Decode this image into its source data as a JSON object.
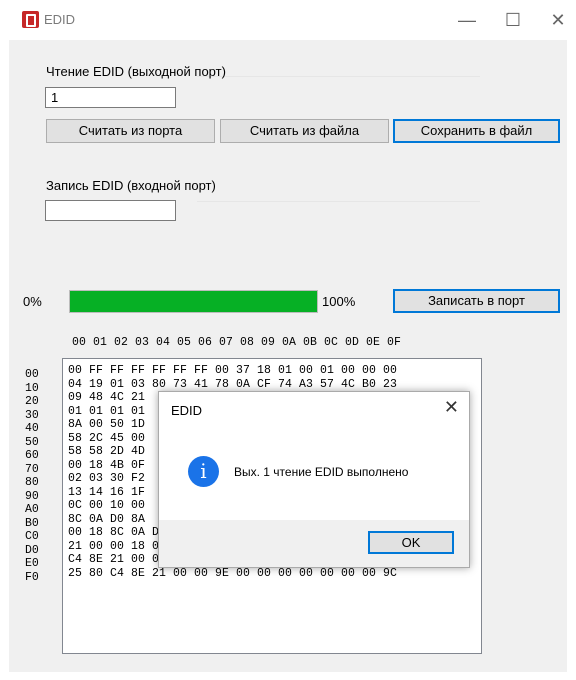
{
  "window": {
    "title": "EDID"
  },
  "read_group": {
    "label": "Чтение EDID (выходной порт)",
    "port_value": "1"
  },
  "buttons": {
    "read_port": "Считать из порта",
    "read_file": "Считать из файла",
    "save_file": "Сохранить в файл",
    "write_port": "Записать в порт"
  },
  "write_group": {
    "label": "Запись EDID (входной порт)",
    "port_value": ""
  },
  "progress": {
    "min_label": "0%",
    "max_label": "100%",
    "value_percent": 100,
    "color": "#06b025"
  },
  "hex": {
    "header": "00 01 02 03 04 05 06 07 08 09 0A 0B 0C 0D 0E 0F",
    "addresses": [
      "00",
      "10",
      "20",
      "30",
      "40",
      "50",
      "60",
      "70",
      "80",
      "90",
      "A0",
      "B0",
      "C0",
      "D0",
      "E0",
      "F0"
    ],
    "rows": [
      "00 FF FF FF FF FF FF 00 37 18 01 00 01 00 00 00",
      "04 19 01 03 80 73 41 78 0A CF 74 A3 57 4C B0 23",
      "09 48 4C 21",
      "01 01 01 01",
      "8A 00 50 1D",
      "58 2C 45 00",
      "58 58 2D 4D",
      "00 18 4B 0F",
      "02 03 30 F2",
      "13 14 16 1F",
      "0C 00 10 00",
      "8C 0A D0 8A",
      "00 18 8C 0A D0 90 20 40 31 20 0C 40 55 00 C4 8E",
      "21 00 00 18 01 1D 00 BC 52 D0 1E 20 B8 28 55 40",
      "C4 8E 21 00 00 1E 01 1D 80 D0 72 1C 16 20 10 2C",
      "25 80 C4 8E 21 00 00 9E 00 00 00 00 00 00 00 9C"
    ]
  },
  "dialog": {
    "title": "EDID",
    "message": "Вых. 1 чтение EDID выполнено",
    "ok_label": "OK",
    "icon": "info-icon"
  }
}
